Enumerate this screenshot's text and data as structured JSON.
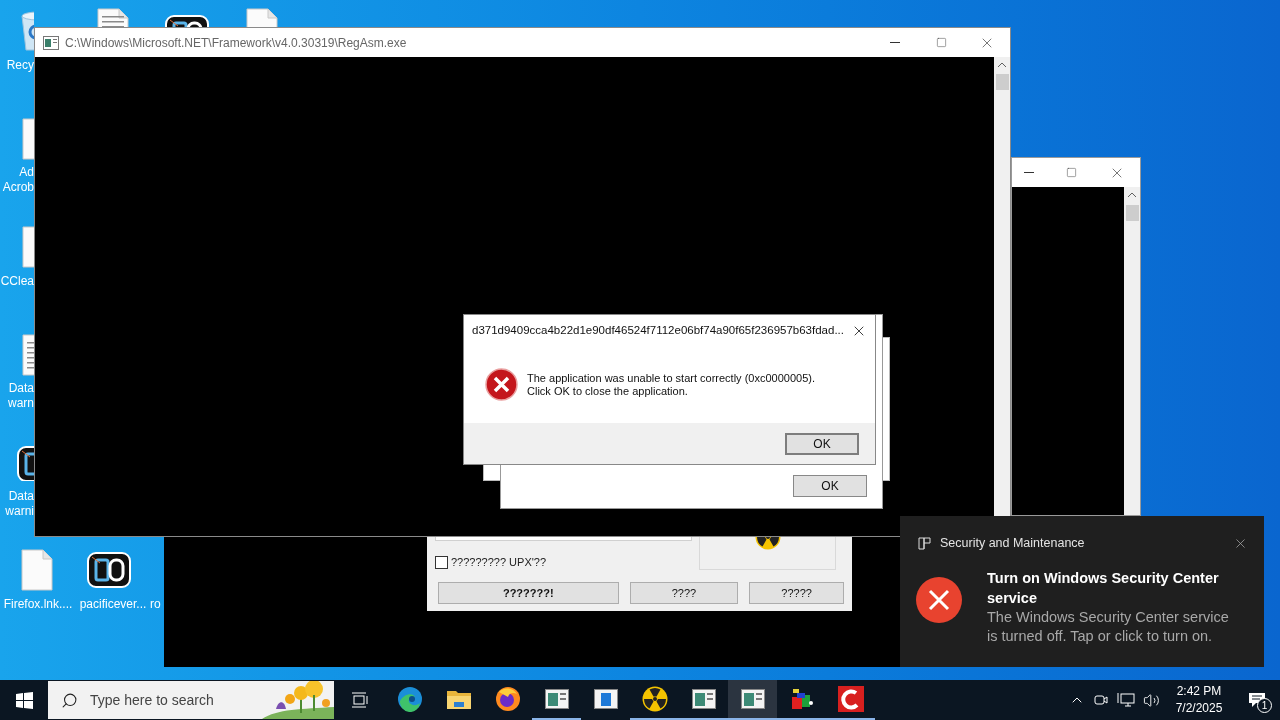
{
  "desktop": {
    "icons": [
      {
        "kind": "recycle-bin",
        "lines": [
          "Recy"
        ]
      },
      {
        "kind": "text-file"
      },
      {
        "kind": "app-logo"
      },
      {
        "kind": "blank-file"
      },
      {
        "kind": "blank-file",
        "lines": [
          "Ad",
          "Acrob"
        ]
      },
      {
        "kind": "blank-file",
        "lines": [
          "CClea"
        ]
      },
      {
        "kind": "text-file",
        "lines": [
          "Data",
          "warn"
        ]
      },
      {
        "kind": "app-logo",
        "lines": [
          "Data",
          "warni"
        ]
      },
      {
        "kind": "blank-file",
        "lines": [
          "Firefox.lnk...."
        ]
      },
      {
        "kind": "app-logo",
        "lines": [
          "pacificever..."
        ]
      },
      {
        "lines": [
          "ro"
        ]
      }
    ]
  },
  "console_window": {
    "title": "C:\\Windows\\Microsoft.NET\\Framework\\v4.0.30319\\RegAsm.exe"
  },
  "tool_window": {
    "checkbox": {
      "label": "????????? UPX'??",
      "checked": false
    },
    "buttons": [
      {
        "label": "???????!",
        "default": true
      },
      {
        "label": "????",
        "default": false
      },
      {
        "label": "?????",
        "default": false
      }
    ]
  },
  "back_dialog": {
    "button": "OK"
  },
  "error_dialog": {
    "title": "d371d9409cca4b22d1e90df46524f7112e06bf74a90f65f236957b63fdad...",
    "message": [
      "The application was unable to start correctly (0xc0000005).",
      "Click OK to close the application."
    ],
    "button": "OK"
  },
  "notification": {
    "source": "Security and Maintenance",
    "title": "Turn on Windows Security Center service",
    "body": "The Windows Security Center service is turned off. Tap or click to turn on."
  },
  "taskbar": {
    "search": {
      "placeholder": "Type here to search"
    },
    "apps": [
      {
        "kind": "edge",
        "open": false,
        "selected": false
      },
      {
        "kind": "folder",
        "open": false,
        "selected": false
      },
      {
        "kind": "firefox",
        "open": false,
        "selected": false
      },
      {
        "kind": "console",
        "open": true,
        "selected": false
      },
      {
        "kind": "blue-window",
        "open": false,
        "selected": false
      },
      {
        "kind": "radiation",
        "open": true,
        "selected": false
      },
      {
        "kind": "console",
        "open": true,
        "selected": false
      },
      {
        "kind": "console",
        "open": true,
        "selected": true
      },
      {
        "kind": "cubes",
        "open": true,
        "selected": false
      },
      {
        "kind": "red-c",
        "open": true,
        "selected": false
      }
    ],
    "time": "2:42 PM",
    "date": "7/2/2025",
    "notification_count": "1"
  }
}
